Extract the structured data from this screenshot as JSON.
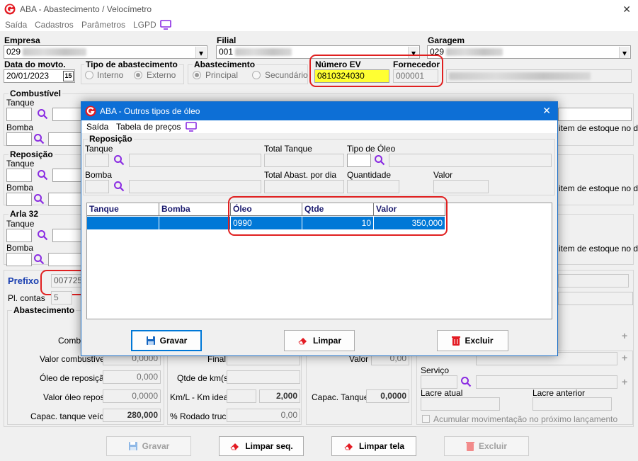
{
  "window": {
    "title": "ABA - Abastecimento / Velocímetro",
    "close": "✕"
  },
  "menu": [
    "Saída",
    "Cadastros",
    "Parâmetros",
    "LGPD"
  ],
  "header": {
    "empresa_label": "Empresa",
    "empresa_value": "029",
    "filial_label": "Filial",
    "filial_value": "001",
    "garagem_label": "Garagem",
    "garagem_value": "029",
    "data_label": "Data do movto.",
    "data_value": "20/01/2023",
    "cal_label": "15",
    "tipo_label": "Tipo de abastecimento",
    "interno": "Interno",
    "externo": "Externo",
    "abast_label": "Abastecimento",
    "principal": "Principal",
    "secundario": "Secundário",
    "numero_ev_label": "Número EV",
    "numero_ev_value": "0810324030",
    "fornecedor_label": "Fornecedor",
    "fornecedor_value": "000001"
  },
  "left": {
    "combustivel": "Combustível",
    "reposicao": "Reposição",
    "arla": "Arla 32",
    "tanque": "Tanque",
    "bomba": "Bomba",
    "prefixo_label": "Prefixo",
    "prefixo_value": "0077250",
    "plcontas_label": "Pl. contas",
    "plcontas_value": "5",
    "abastecimento": "Abastecimento",
    "combu_label": "Combu",
    "valor_comb_label": "Valor combustível",
    "valor_comb_value": "0,0000",
    "oleo_rep_label": "Óleo de reposição",
    "oleo_rep_value": "0,000",
    "valor_oleo_label": "Valor óleo repos.",
    "valor_oleo_value": "0,0000",
    "capac_label": "Capac. tanque veíc.",
    "capac_value": "280,000",
    "final_label": "Final",
    "qtde_km_label": "Qtde de km(s)",
    "kml_label": "Km/L - Km ideal",
    "kml_value": "2,000",
    "rodado_label": "% Rodado truck",
    "rodado_value": "0,00",
    "valor_label": "Valor",
    "valor_value": "0,00",
    "capac_tanque_label": "Capac. Tanque",
    "capac_tanque_value": "0,0000",
    "estoque_note": "item de estoque no dia",
    "servico_label": "Serviço",
    "lacre_atual": "Lacre atual",
    "lacre_anterior": "Lacre anterior",
    "acumular": "Acumular movimentação no próximo lançamento",
    "total_tanque_hint": "Total tanque",
    "tipo_combustivel_hint": "Tipo de combustível"
  },
  "bottom_buttons": {
    "gravar": "Gravar",
    "limpar_seq": "Limpar seq.",
    "limpar_tela": "Limpar tela",
    "excluir": "Excluir"
  },
  "dialog": {
    "title": "ABA - Outros tipos de óleo",
    "close": "✕",
    "menu": [
      "Saída",
      "Tabela de preços"
    ],
    "reposicao": "Reposição",
    "tanque": "Tanque",
    "total_tanque": "Total Tanque",
    "tipo_oleo": "Tipo de Óleo",
    "bomba": "Bomba",
    "total_abast": "Total Abast. por dia",
    "quantidade": "Quantidade",
    "valor": "Valor",
    "grid": {
      "headers": [
        "Tanque",
        "Bomba",
        "Óleo",
        "Qtde",
        "Valor"
      ],
      "rows": [
        [
          "",
          "",
          "0990",
          "10",
          "350,000"
        ]
      ]
    },
    "buttons": {
      "gravar": "Gravar",
      "limpar": "Limpar",
      "excluir": "Excluir"
    }
  },
  "colors": {
    "accent": "#0078d7",
    "highlight_field": "#ffff33",
    "annotation": "#e02020"
  }
}
